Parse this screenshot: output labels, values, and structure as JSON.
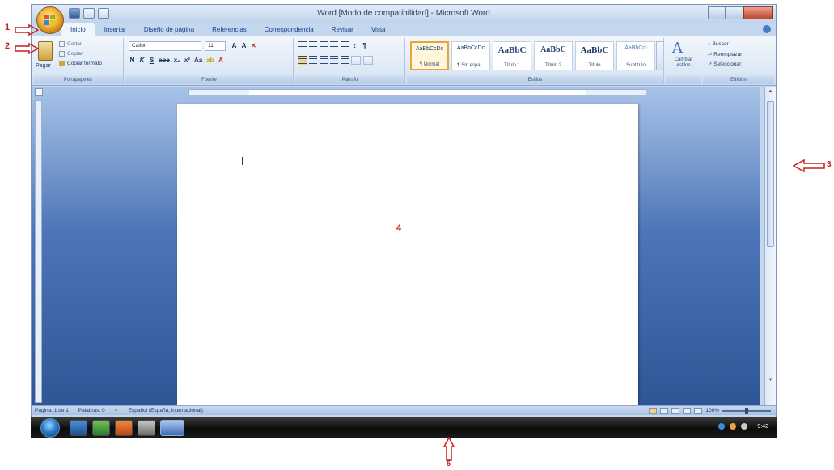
{
  "window": {
    "title": "Word [Modo de compatibilidad] - Microsoft Word"
  },
  "ribbon": {
    "tabs": [
      "Inicio",
      "Insertar",
      "Diseño de página",
      "Referencias",
      "Correspondencia",
      "Revisar",
      "Vista"
    ],
    "clipboard": {
      "paste_label": "Pegar",
      "cut_label": "Cortar",
      "copy_label": "Copiar",
      "format_painter_label": "Copiar formato",
      "group_label": "Portapapeles"
    },
    "font": {
      "font_name": "Calibri",
      "font_size": "11",
      "group_label": "Fuente"
    },
    "paragraph": {
      "group_label": "Párrafo"
    },
    "styles": {
      "group_label": "Estilos",
      "tiles": [
        {
          "sample": "AaBbCcDc",
          "name": "¶ Normal"
        },
        {
          "sample": "AaBbCcDc",
          "name": "¶ Sin espa..."
        },
        {
          "sample": "AaBbC",
          "name": "Título 1"
        },
        {
          "sample": "AaBbC",
          "name": "Título 2"
        },
        {
          "sample": "AaBbC",
          "name": "Título"
        },
        {
          "sample": "AaBbCcI",
          "name": "Subtítulo"
        }
      ],
      "change_styles_label": "Cambiar estilos"
    },
    "editing": {
      "find_label": "Buscar",
      "replace_label": "Reemplazar",
      "select_label": "Seleccionar",
      "group_label": "Edición"
    }
  },
  "statusbar": {
    "page": "Página: 1 de 1",
    "words": "Palabras: 0",
    "language": "Español (España, internacional)",
    "zoom": "100%"
  },
  "taskbar": {
    "clock": "9:42"
  },
  "callouts": {
    "n1": "1",
    "n2": "2",
    "n3": "3",
    "n4": "4",
    "n5": "5"
  },
  "colors": {
    "callout": "#c91f1f",
    "ribbon_accent": "#15428b",
    "selected_style": "#e7a53b"
  }
}
